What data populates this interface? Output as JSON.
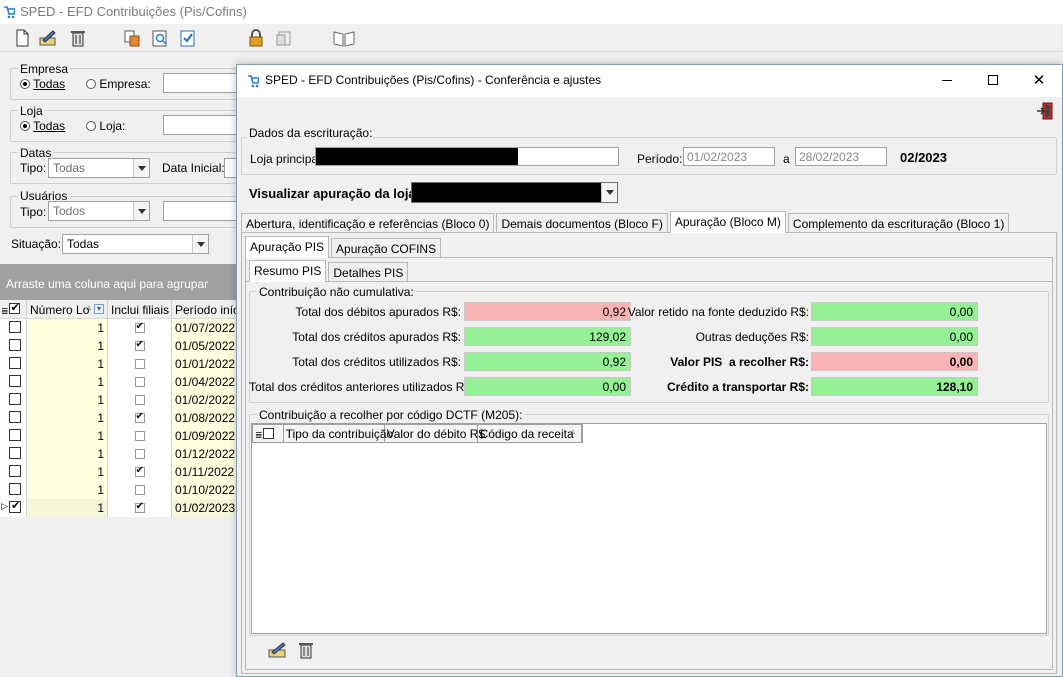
{
  "main_window": {
    "title": "SPED - EFD Contribuições (Pis/Cofins)",
    "filters": {
      "empresa": {
        "caption": "Empresa",
        "opt_all": "Todas",
        "opt_specific": "Empresa:"
      },
      "loja": {
        "caption": "Loja",
        "opt_all": "Todas",
        "opt_specific": "Loja:"
      },
      "datas": {
        "caption": "Datas",
        "tipo_label": "Tipo:",
        "tipo_value": "Todas",
        "data_inicial_label": "Data Inicial:"
      },
      "usuarios": {
        "caption": "Usuários",
        "tipo_label": "Tipo:",
        "tipo_value": "Todos"
      },
      "situacao": {
        "label": "Situação:",
        "value": "Todas"
      }
    },
    "group_banner": "Arraste uma coluna aqui para agrupar",
    "grid": {
      "columns": [
        "Número Lo",
        "Inclui filiais",
        "Período iníci"
      ],
      "rows": [
        {
          "numero": "1",
          "inclui_filiais": true,
          "periodo": "01/07/2022"
        },
        {
          "numero": "1",
          "inclui_filiais": true,
          "periodo": "01/05/2022"
        },
        {
          "numero": "1",
          "inclui_filiais": false,
          "periodo": "01/01/2022"
        },
        {
          "numero": "1",
          "inclui_filiais": false,
          "periodo": "01/04/2022"
        },
        {
          "numero": "1",
          "inclui_filiais": false,
          "periodo": "01/02/2022"
        },
        {
          "numero": "1",
          "inclui_filiais": true,
          "periodo": "01/08/2022"
        },
        {
          "numero": "1",
          "inclui_filiais": false,
          "periodo": "01/09/2022"
        },
        {
          "numero": "1",
          "inclui_filiais": false,
          "periodo": "01/12/2022"
        },
        {
          "numero": "1",
          "inclui_filiais": true,
          "periodo": "01/11/2022"
        },
        {
          "numero": "1",
          "inclui_filiais": false,
          "periodo": "01/10/2022"
        },
        {
          "numero": "1",
          "inclui_filiais": true,
          "periodo": "01/02/2023",
          "selected": true
        }
      ]
    }
  },
  "dialog": {
    "title": "SPED - EFD Contribuições (Pis/Cofins) - Conferência e ajustes",
    "dados_caption": "Dados da escrituração:",
    "loja_principal_label": "Loja principal:",
    "periodo_label": "Período:",
    "periodo_de": "01/02/2023",
    "periodo_a_label": "a",
    "periodo_ate": "28/02/2023",
    "competencia": "02/2023",
    "visualizar_label": "Visualizar apuração da loja:",
    "tabs": [
      {
        "label": "Abertura, identificação e referências (Bloco 0)",
        "active": false
      },
      {
        "label": "Demais documentos (Bloco F)",
        "active": false
      },
      {
        "label": "Apuração (Bloco M)",
        "active": true
      },
      {
        "label": "Complemento da escrituração (Bloco 1)",
        "active": false
      }
    ],
    "subtabs": [
      {
        "label": "Apuração PIS",
        "active": true
      },
      {
        "label": "Apuração COFINS",
        "active": false
      }
    ],
    "subsubtabs": [
      {
        "label": "Resumo PIS",
        "active": true
      },
      {
        "label": "Detalhes PIS",
        "active": false
      }
    ],
    "contribuicao": {
      "caption": "Contribuição não cumulativa:",
      "left": [
        {
          "label": "Total dos débitos apurados R$:",
          "value": "0,92",
          "color": "red"
        },
        {
          "label": "Total dos créditos apurados R$:",
          "value": "129,02",
          "color": "green"
        },
        {
          "label": "Total dos créditos utilizados R$:",
          "value": "0,92",
          "color": "green"
        },
        {
          "label": "Total dos créditos anteriores utilizados R$:",
          "value": "0,00",
          "color": "green"
        }
      ],
      "right": [
        {
          "label": "Valor retido na fonte deduzido R$:",
          "value": "0,00",
          "color": "green",
          "bold": false
        },
        {
          "label": "Outras deduções R$:",
          "value": "0,00",
          "color": "green",
          "bold": false
        },
        {
          "label": "Valor PIS  a recolher R$:",
          "value": "0,00",
          "color": "red",
          "bold": true
        },
        {
          "label": "Crédito a transportar R$:",
          "value": "128,10",
          "color": "green",
          "bold": true
        }
      ]
    },
    "dctf": {
      "caption": "Contribuição a recolher por código DCTF (M205):",
      "columns": [
        "Tipo da contribuição",
        "Valor do débito R$",
        "Código da receita"
      ]
    },
    "colors": {
      "green": "#96f096",
      "red": "#f8b4b4"
    }
  }
}
